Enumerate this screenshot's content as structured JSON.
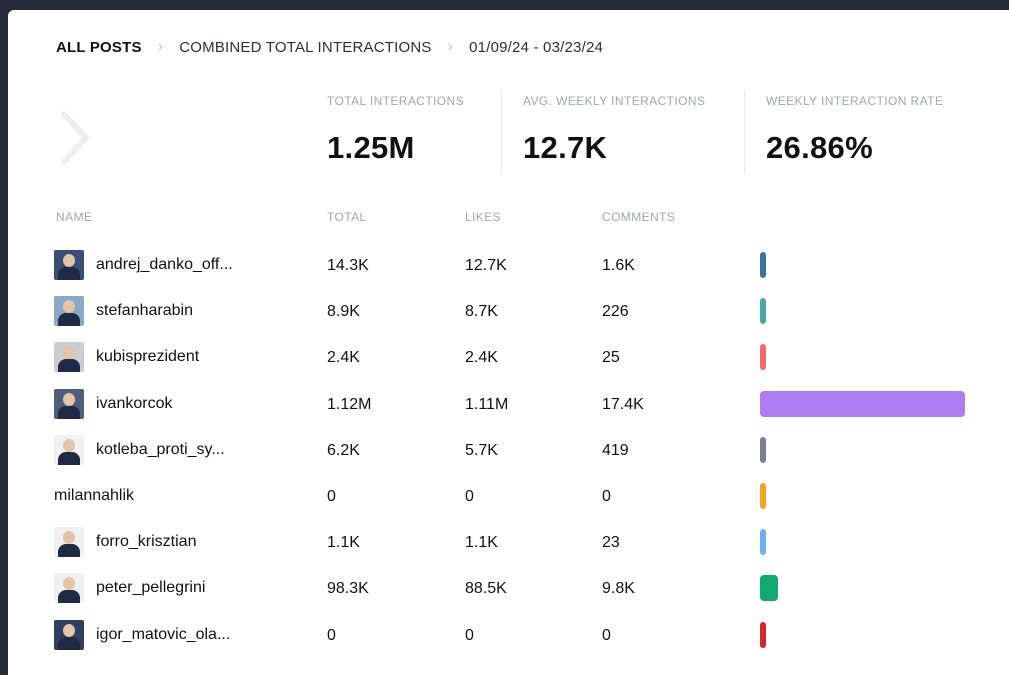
{
  "breadcrumb": {
    "root": "ALL POSTS",
    "section": "COMBINED TOTAL INTERACTIONS",
    "date_range": "01/09/24 - 03/23/24"
  },
  "stats": [
    {
      "label": "TOTAL INTERACTIONS",
      "value": "1.25M"
    },
    {
      "label": "AVG. WEEKLY INTERACTIONS",
      "value": "12.7K"
    },
    {
      "label": "WEEKLY INTERACTION RATE",
      "value": "26.86%"
    }
  ],
  "table": {
    "columns": [
      "NAME",
      "TOTAL",
      "LIKES",
      "COMMENTS"
    ],
    "rows": [
      {
        "name": "andrej_danko_off...",
        "total": "14.3K",
        "likes": "12.7K",
        "comments": "1.6K",
        "avatar": true,
        "avatar_bg": "#3a4e73",
        "bar_color": "#3f6fa8",
        "share": 0.0114
      },
      {
        "name": "stefanharabin",
        "total": "8.9K",
        "likes": "8.7K",
        "comments": "226",
        "avatar": true,
        "avatar_bg": "#8aa6c8",
        "bar_color": "#4aa9a2",
        "share": 0.0071
      },
      {
        "name": "kubisprezident",
        "total": "2.4K",
        "likes": "2.4K",
        "comments": "25",
        "avatar": true,
        "avatar_bg": "#c9ccd2",
        "bar_color": "#ef6b6b",
        "share": 0.0019
      },
      {
        "name": "ivankorcok",
        "total": "1.12M",
        "likes": "1.11M",
        "comments": "17.4K",
        "avatar": true,
        "avatar_bg": "#4d5f7a",
        "bar_color": "#b07cf2",
        "share": 0.896
      },
      {
        "name": "kotleba_proti_sy...",
        "total": "6.2K",
        "likes": "5.7K",
        "comments": "419",
        "avatar": true,
        "avatar_bg": "#f1f1f1",
        "bar_color": "#7a8292",
        "share": 0.005
      },
      {
        "name": "milannahlik",
        "total": "0",
        "likes": "0",
        "comments": "0",
        "avatar": false,
        "avatar_bg": "",
        "bar_color": "#f4a228",
        "share": 0
      },
      {
        "name": "forro_krisztian",
        "total": "1.1K",
        "likes": "1.1K",
        "comments": "23",
        "avatar": true,
        "avatar_bg": "#f1f1f1",
        "bar_color": "#6cb2ee",
        "share": 0.0009
      },
      {
        "name": "peter_pellegrini",
        "total": "98.3K",
        "likes": "88.5K",
        "comments": "9.8K",
        "avatar": true,
        "avatar_bg": "#f1f1f1",
        "bar_color": "#12a872",
        "share": 0.0786
      },
      {
        "name": "igor_matovic_ola...",
        "total": "0",
        "likes": "0",
        "comments": "0",
        "avatar": true,
        "avatar_bg": "#2f3f60",
        "bar_color": "#d02a2a",
        "share": 0
      }
    ]
  }
}
